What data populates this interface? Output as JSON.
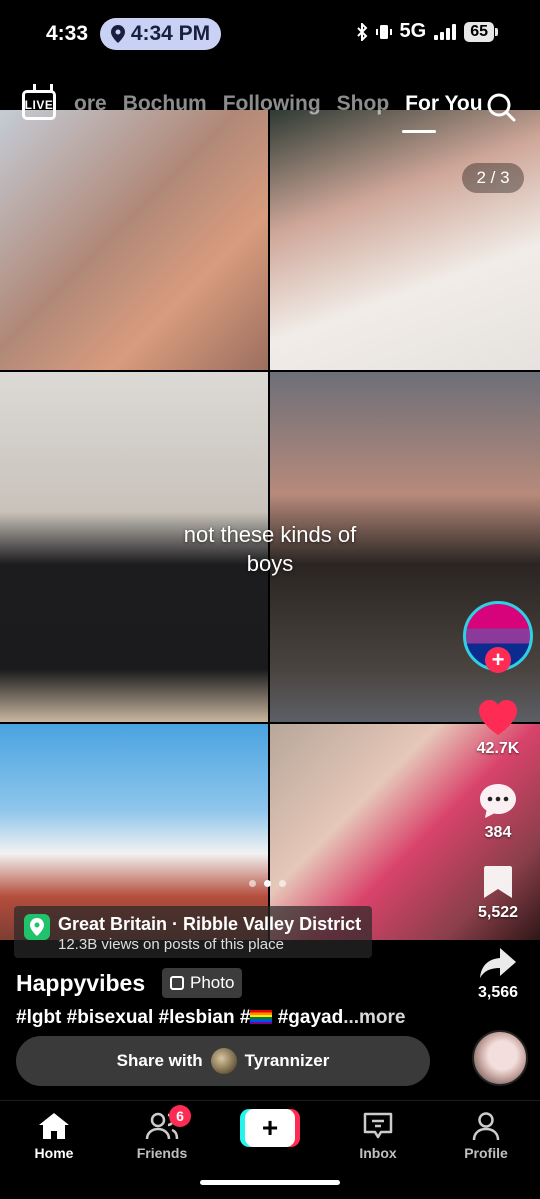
{
  "status_bar": {
    "time": "4:33",
    "location_time": "4:34 PM",
    "network": "5G",
    "battery": "65"
  },
  "top_nav": {
    "live_label": "LIVE",
    "tabs": [
      {
        "label": "ore"
      },
      {
        "label": "Bochum"
      },
      {
        "label": "Following"
      },
      {
        "label": "Shop"
      },
      {
        "label": "For You"
      }
    ]
  },
  "post": {
    "image_counter": "2 / 3",
    "overlay_text": "not these kinds of boys",
    "location": {
      "title": "Great Britain · Ribble Valley District",
      "subtitle": "12.3B views on posts of this place"
    },
    "author": "Happyvibes",
    "type_badge": "Photo",
    "caption_start": "#lgbt #bisexual #lesbian #",
    "caption_end": " #gayad",
    "more_label": "...more",
    "share_prefix": "Share with",
    "share_user": "Tyrannizer"
  },
  "actions": {
    "likes": "42.7K",
    "comments": "384",
    "bookmarks": "5,522",
    "shares": "3,566"
  },
  "bottom_nav": {
    "home": "Home",
    "friends": "Friends",
    "friends_badge": "6",
    "inbox": "Inbox",
    "profile": "Profile"
  },
  "colors": {
    "accent_red": "#fe2c55",
    "accent_cyan": "#25f4ee",
    "location_green": "#20c36a"
  }
}
